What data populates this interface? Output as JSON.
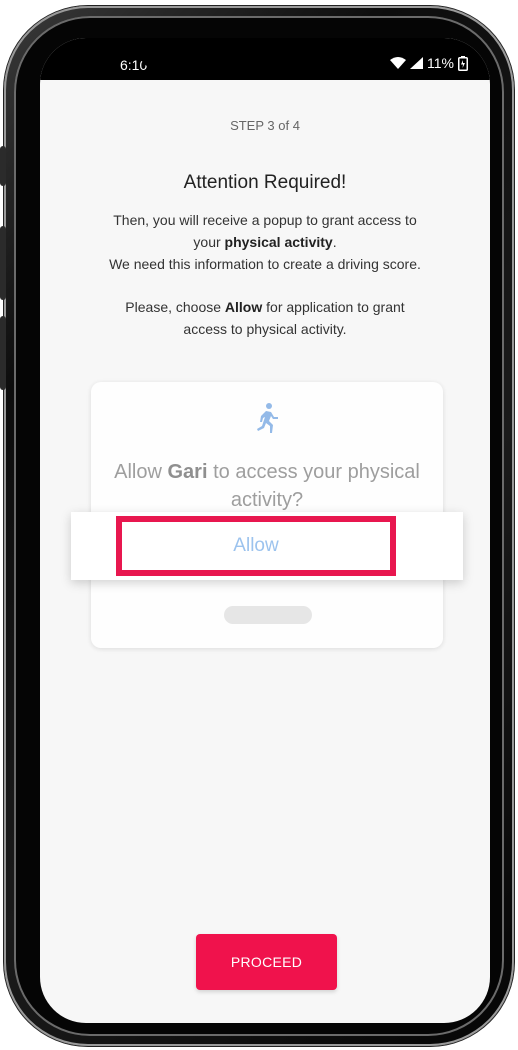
{
  "status_bar": {
    "time": "6:10",
    "battery": "11%",
    "icons": [
      "wifi-icon",
      "signal-icon",
      "battery-icon"
    ]
  },
  "onboarding": {
    "step_label": "STEP 3 of  4",
    "title": "Attention Required!",
    "intro_line1": "Then, you will receive a popup to grant access to",
    "intro_line2_prefix": "your ",
    "intro_line2_bold": "physical activity",
    "intro_line2_suffix": ".",
    "intro_line3": "We need this information to create a driving score.",
    "choose_prefix": "Please, choose ",
    "choose_bold": "Allow",
    "choose_suffix": " for application to grant",
    "choose_line2": "access to physical activity."
  },
  "illustration": {
    "icon": "running-person-icon",
    "question_prefix": "Allow ",
    "question_app": "Gari",
    "question_suffix": " to access your physical",
    "question_line2": "activity?",
    "allow_label": "Allow"
  },
  "footer": {
    "proceed_label": "PROCEED"
  },
  "colors": {
    "accent": "#f0124c",
    "highlight_border": "#e8174f",
    "allow_text": "#9cc3ee",
    "icon_blue": "#8fb7e8"
  }
}
